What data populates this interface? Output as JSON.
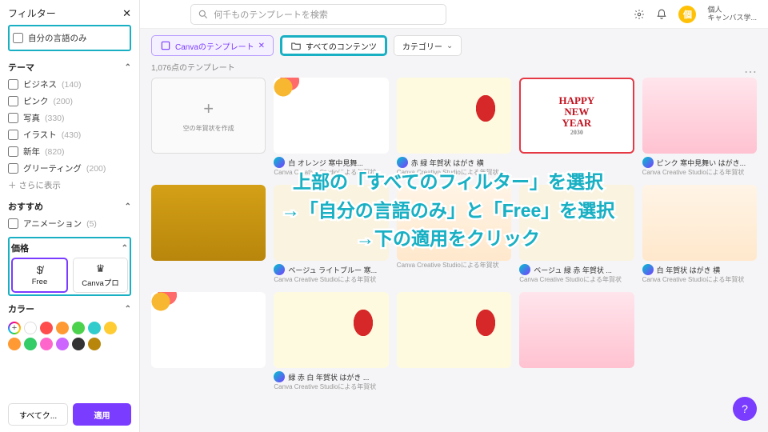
{
  "topbar": {
    "search_placeholder": "何千ものテンプレートを検索",
    "account_line1": "個人",
    "account_line2": "キャンバス学...",
    "avatar_letter": "個"
  },
  "filter": {
    "title": "フィルター",
    "own_language": "自分の言語のみ",
    "theme_title": "テーマ",
    "themes": [
      {
        "label": "ビジネス",
        "count": "(140)"
      },
      {
        "label": "ピンク",
        "count": "(200)"
      },
      {
        "label": "写真",
        "count": "(330)"
      },
      {
        "label": "イラスト",
        "count": "(430)"
      },
      {
        "label": "新年",
        "count": "(820)"
      },
      {
        "label": "グリーティング",
        "count": "(200)"
      }
    ],
    "more": "さらに表示",
    "recommend_title": "おすすめ",
    "recommend_item": "アニメーション",
    "recommend_count": "(5)",
    "price_title": "価格",
    "price_free": "Free",
    "price_pro": "Canvaプロ",
    "color_title": "カラー",
    "colors": [
      "#ffffff",
      "#ff4d4d",
      "#ff9933",
      "#4dd24d",
      "#33cccc",
      "#ffcc33",
      "#ff9933",
      "#33cc66",
      "#ff66cc",
      "#cc66ff",
      "#333333",
      "#b8860b"
    ],
    "clear": "すべてク...",
    "apply": "適用"
  },
  "chips": {
    "canva": "Canvaのテンプレート",
    "all": "すべてのコンテンツ",
    "category": "カテゴリー"
  },
  "count": "1,076点のテンプレート",
  "cards": [
    {
      "blank": true,
      "title": "空の年賀状を作成"
    },
    {
      "title": "白 オレンジ 寒中見舞...",
      "sub": "Canva Creative Studioによる年賀状",
      "cls": "th-flowers"
    },
    {
      "title": "赤 緑 年賀状 はがき 横",
      "sub": "Canva Creative Studioによる年賀状",
      "cls": "th-daruma"
    },
    {
      "title": "",
      "sub": "",
      "cls": "th-happy",
      "big": "HAPPY\nNEW\nYEAR",
      "year": "2030"
    },
    {
      "title": "ピンク 寒中見舞い はがき...",
      "sub": "Canva Creative Studioによる年賀状",
      "cls": "th-pink"
    },
    {
      "title": "",
      "sub": "",
      "cls": "th-gold"
    },
    {
      "title": "ベージュ ライトブルー 寒...",
      "sub": "Canva Creative Studioによる年賀状",
      "cls": "th-beige"
    },
    {
      "title": "",
      "sub": "Canva Creative Studioによる年賀状",
      "cls": "th-family"
    },
    {
      "title": "ベージュ 緑 赤 年賀状 ...",
      "sub": "Canva Creative Studioによる年賀状",
      "cls": "th-beige"
    },
    {
      "title": "白 年賀状 はがき 横",
      "sub": "Canva Creative Studioによる年賀状",
      "cls": "th-family"
    },
    {
      "title": "",
      "sub": "",
      "cls": "th-flowers"
    },
    {
      "title": "緑 赤 白 年賀状 はがき ...",
      "sub": "Canva Creative Studioによる年賀状",
      "cls": "th-daruma"
    },
    {
      "title": "",
      "sub": "",
      "cls": "th-daruma"
    },
    {
      "title": "",
      "sub": "",
      "cls": "th-pink"
    }
  ],
  "overlay": {
    "l1": "上部の「すべてのフィルター」を選択",
    "l2": "→「自分の言語のみ」と「Free」を選択",
    "l3": "→下の適用をクリック"
  }
}
